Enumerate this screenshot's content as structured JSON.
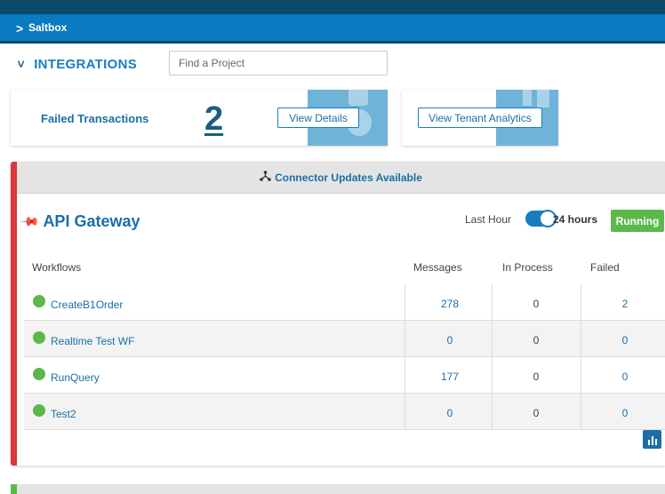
{
  "breadcrumb": {
    "chevron": ">",
    "label": "Saltbox"
  },
  "section": {
    "title": "INTEGRATIONS"
  },
  "search": {
    "placeholder": "Find a Project",
    "value": ""
  },
  "failed_card": {
    "label": "Failed Transactions",
    "count": "2",
    "button": "View Details"
  },
  "analytics_card": {
    "button": "View Tenant Analytics"
  },
  "banner": {
    "icon": "share-icon",
    "text": "Connector Updates Available"
  },
  "gateway": {
    "title": "API Gateway",
    "pin_icon": "pin-icon",
    "toggle_left": "Last Hour",
    "toggle_right": "24 hours",
    "toggle_state": "on",
    "status": "Running",
    "status_color": "#5cb84a"
  },
  "table": {
    "headers": {
      "workflows": "Workflows",
      "messages": "Messages",
      "in_process": "In Process",
      "failed": "Failed"
    },
    "rows": [
      {
        "name": "CreateB1Order",
        "messages": "278",
        "in_process": "0",
        "failed": "2"
      },
      {
        "name": "Realtime Test WF",
        "messages": "0",
        "in_process": "0",
        "failed": "0"
      },
      {
        "name": "RunQuery",
        "messages": "177",
        "in_process": "0",
        "failed": "0"
      },
      {
        "name": "Test2",
        "messages": "0",
        "in_process": "0",
        "failed": "0"
      }
    ]
  },
  "chart_button_icon": "bar-chart-icon",
  "colors": {
    "accent": "#1a7cbf",
    "header": "#0a7bc1",
    "alert": "#d9373a",
    "success": "#5cb84a"
  }
}
